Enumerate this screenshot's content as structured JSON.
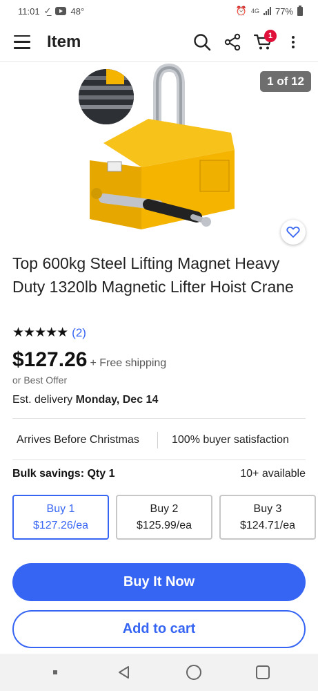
{
  "status_bar": {
    "time": "11:01",
    "temperature": "48°",
    "battery": "77%"
  },
  "app_bar": {
    "title": "Item",
    "cart_count": "1"
  },
  "gallery": {
    "counter": "1 of 12"
  },
  "product": {
    "title": "Top 600kg Steel Lifting Magnet Heavy Duty 1320lb Magnetic Lifter Hoist Crane",
    "stars": "★★★★★",
    "rating": 5,
    "rating_count": "(2)",
    "price": "$127.26",
    "shipping": "+ Free shipping",
    "best_offer": "or Best Offer",
    "delivery_prefix": "Est. delivery ",
    "delivery_date": "Monday, Dec 14"
  },
  "perks": {
    "first": "Arrives Before Christmas",
    "second": "100% buyer satisfaction"
  },
  "bulk": {
    "label": "Bulk savings: Qty 1",
    "available": "10+ available",
    "options": [
      {
        "label": "Buy 1",
        "price": "$127.26/ea"
      },
      {
        "label": "Buy 2",
        "price": "$125.99/ea"
      },
      {
        "label": "Buy 3",
        "price": "$124.71/ea"
      }
    ]
  },
  "actions": {
    "buy_now": "Buy It Now",
    "add_to_cart": "Add to cart"
  },
  "colors": {
    "accent": "#3665f3",
    "badge": "#e0103a",
    "magnet_yellow": "#f5b400"
  }
}
